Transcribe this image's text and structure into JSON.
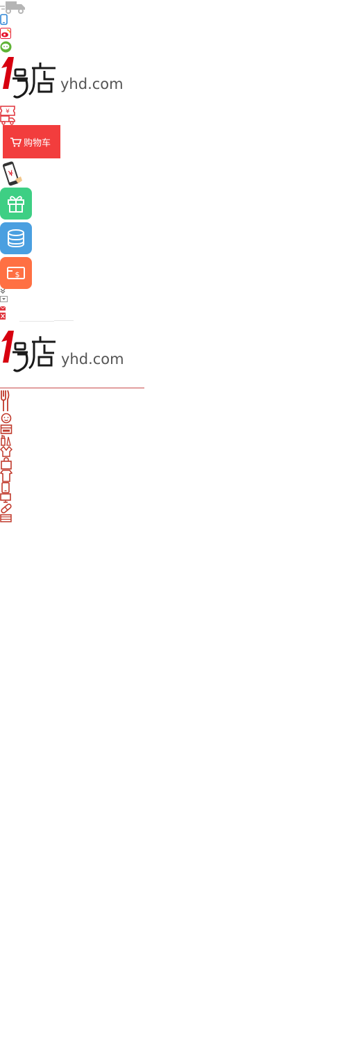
{
  "header": {
    "logo": {
      "brand_mark": "1号店",
      "domain_text": "yhd.com"
    },
    "top_icons": [
      {
        "name": "delivery-truck-icon"
      },
      {
        "name": "mobile-phone-icon"
      },
      {
        "name": "weibo-icon"
      },
      {
        "name": "wechat-icon"
      }
    ]
  },
  "cart": {
    "label": "购物车",
    "icon": "cart-icon"
  },
  "promo_icons": [
    {
      "name": "coupon-icon"
    },
    {
      "name": "delivery-van-icon"
    },
    {
      "name": "mobile-payment-icon"
    }
  ],
  "feature_tiles": [
    {
      "name": "gift-icon",
      "color": "#3ecf84"
    },
    {
      "name": "database-icon",
      "color": "#4a9fe0"
    },
    {
      "name": "card-payment-icon",
      "color": "#ff7043"
    }
  ],
  "colors": {
    "brand_red": "#d7000f",
    "cart_red": "#f23d3d",
    "category_red": "#c0392b",
    "divider_red": "#c94a4a"
  },
  "footer_logo": {
    "brand_mark": "1号店",
    "domain_text": "yhd.com"
  },
  "category_icons": [
    {
      "name": "food-utensils-icon"
    },
    {
      "name": "baby-face-icon"
    },
    {
      "name": "kitchen-appliance-icon"
    },
    {
      "name": "cosmetics-icon"
    },
    {
      "name": "clothing-icon"
    },
    {
      "name": "shopping-bag-icon"
    },
    {
      "name": "shirt-icon"
    },
    {
      "name": "phone-icon"
    },
    {
      "name": "computer-icon"
    },
    {
      "name": "medicine-icon"
    },
    {
      "name": "books-icon"
    }
  ]
}
